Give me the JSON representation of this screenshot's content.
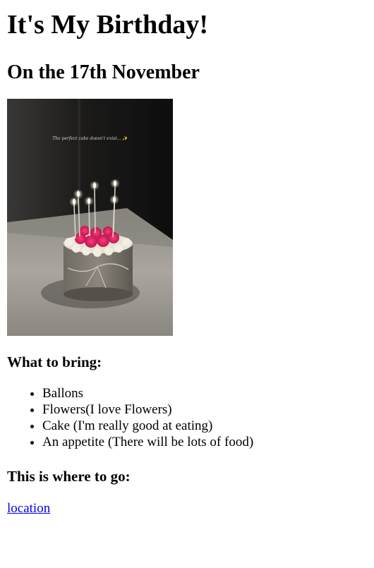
{
  "page": {
    "title": "It's My Birthday!",
    "date": "On the 17th November",
    "photo": {
      "caption": "The perfect cake doesn't exist... ✨"
    },
    "bring": {
      "heading": "What to bring:",
      "items": [
        "Ballons",
        "Flowers(I love Flowers)",
        "Cake (I'm really good at eating)",
        "An appetite (There will be lots of food)"
      ]
    },
    "where": {
      "heading": "This is where to go:",
      "link_text": "location"
    }
  },
  "colors": {
    "link": "#0000ee",
    "text": "#000000",
    "background": "#ffffff"
  }
}
